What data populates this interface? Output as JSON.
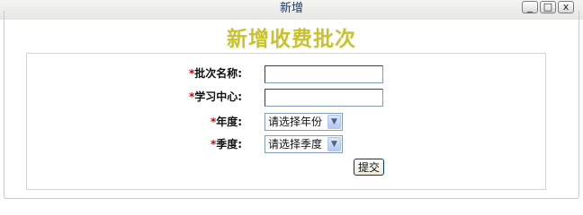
{
  "window": {
    "title": "新增"
  },
  "window_controls": {
    "minimize": "_",
    "maximize": "□",
    "close": "x"
  },
  "heading": "新增收费批次",
  "form": {
    "required_mark": "*",
    "batch_name": {
      "label": "批次名称:",
      "value": ""
    },
    "study_center": {
      "label": "学习中心:",
      "value": ""
    },
    "year": {
      "label": "年度:",
      "selected": "请选择年份"
    },
    "quarter": {
      "label": "季度:",
      "selected": "请选择季度"
    },
    "submit_label": "提交"
  }
}
